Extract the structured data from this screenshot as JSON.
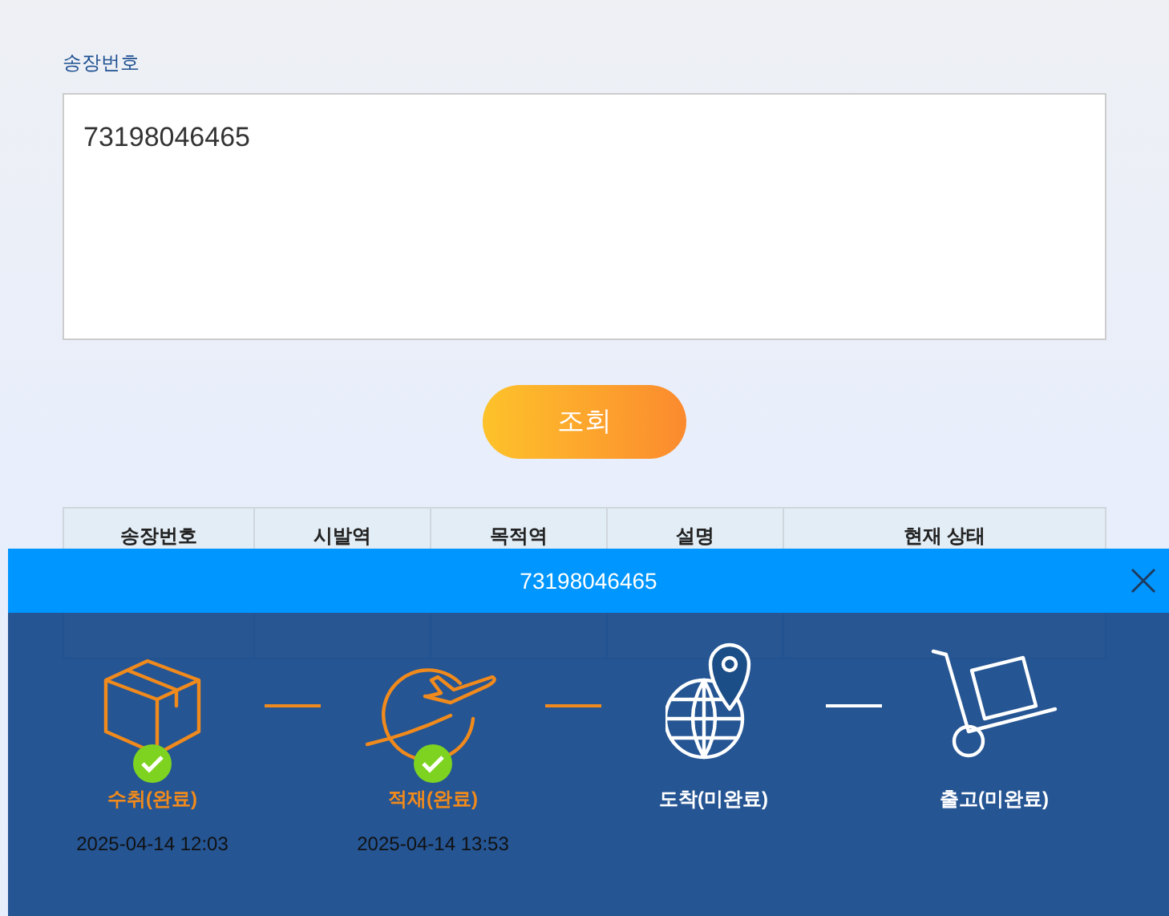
{
  "form": {
    "label": "송장번호",
    "value": "73198046465",
    "button": "조회"
  },
  "table": {
    "columns": [
      "송장번호",
      "시발역",
      "목적역",
      "설명",
      "현재 상태"
    ]
  },
  "modal": {
    "title": "73198046465",
    "steps": [
      {
        "kind": "box",
        "label": "수취(완료)",
        "time": "2025-04-14 12:03",
        "done": true
      },
      {
        "kind": "plane",
        "label": "적재(완료)",
        "time": "2025-04-14 13:53",
        "done": true
      },
      {
        "kind": "globe",
        "label": "도착(미완료)",
        "done": false
      },
      {
        "kind": "cart",
        "label": "출고(미완료)",
        "done": false
      }
    ]
  }
}
